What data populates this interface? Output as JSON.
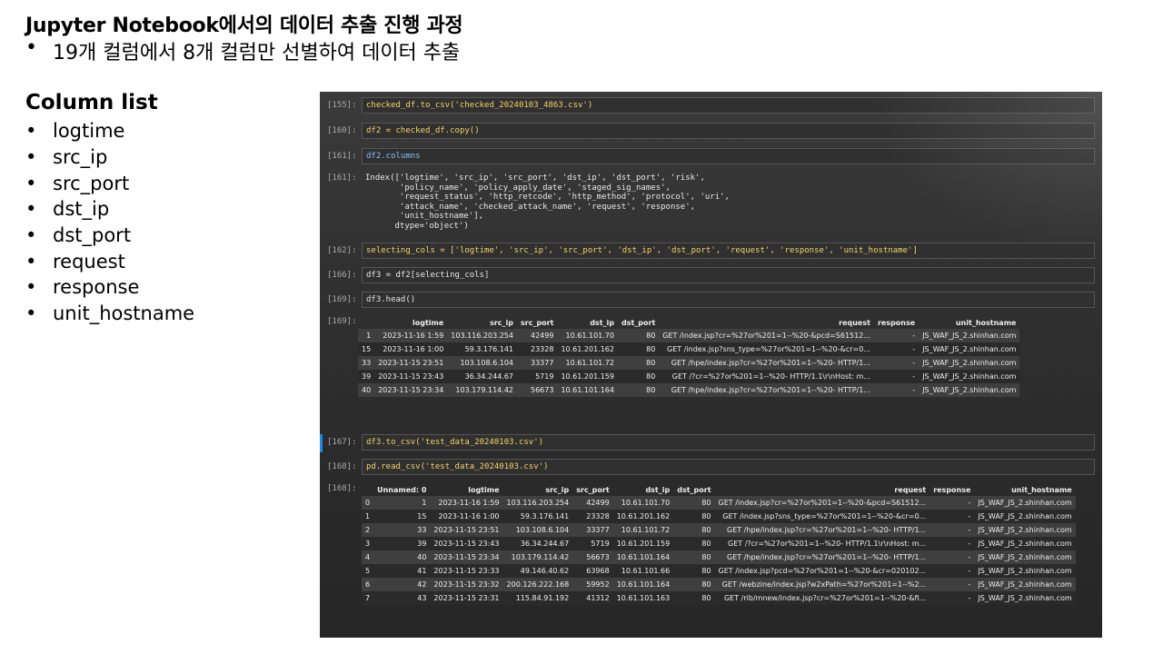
{
  "slide": {
    "title": "Jupyter Notebook에서의 데이터 추출 진행 과정",
    "bullet": "19개 컬럼에서 8개 컬럼만 선별하여 데이터 추출",
    "bullet_marker": "•",
    "column_list_title": "Column list",
    "columns": [
      "logtime",
      "src_ip",
      "src_port",
      "dst_ip",
      "dst_port",
      "request",
      "response",
      "unit_hostname"
    ]
  },
  "notebook": {
    "cells": [
      {
        "prompt": "[155]:",
        "code": "checked_df.to_csv('checked_20240103_4863.csv')"
      },
      {
        "prompt": "[160]:",
        "code": "df2 = checked_df.copy()"
      },
      {
        "prompt": "[161]:",
        "code": "df2.columns"
      },
      {
        "prompt": "[161]:",
        "output": "Index(['logtime', 'src_ip', 'src_port', 'dst_ip', 'dst_port', 'risk',\n       'policy_name', 'policy_apply_date', 'staged_sig_names',\n       'request_status', 'http_retcode', 'http_method', 'protocol', 'uri',\n       'attack_name', 'checked_attack_name', 'request', 'response',\n       'unit_hostname'],\n      dtype='object')"
      },
      {
        "prompt": "[162]:",
        "code": "selecting_cols = ['logtime', 'src_ip', 'src_port', 'dst_ip', 'dst_port', 'request', 'response', 'unit_hostname']"
      },
      {
        "prompt": "[166]:",
        "code": "df3 = df2[selecting_cols]"
      },
      {
        "prompt": "[169]:",
        "code": "df3.head()"
      },
      {
        "prompt": "[169]:"
      },
      {
        "prompt": "[167]:",
        "code": "df3.to_csv('test_data_20240103.csv')"
      },
      {
        "prompt": "[168]:",
        "code": "pd.read_csv('test_data_20240103.csv')"
      },
      {
        "prompt": "[168]:"
      }
    ],
    "head_table": {
      "headers": [
        "",
        "logtime",
        "src_ip",
        "src_port",
        "dst_ip",
        "dst_port",
        "request",
        "response",
        "unit_hostname"
      ],
      "rows": [
        [
          "1",
          "2023-11-16 1:59",
          "103.116.203.254",
          "42499",
          "10.61.101.70",
          "80",
          "GET /index.jsp?cr=%27or%201=1--%20-&pcd=S61512...",
          "-",
          "JS_WAF_JS_2.shinhan.com"
        ],
        [
          "15",
          "2023-11-16 1:00",
          "59.3.176.141",
          "23328",
          "10.61.201.162",
          "80",
          "GET /index.jsp?sns_type=%27or%201=1--%20-&cr=0...",
          "-",
          "JS_WAF_JS_2.shinhan.com"
        ],
        [
          "33",
          "2023-11-15 23:51",
          "103.108.6.104",
          "33377",
          "10.61.101.72",
          "80",
          "GET /hpe/index.jsp?cr=%27or%201=1--%20- HTTP/1...",
          "-",
          "JS_WAF_JS_2.shinhan.com"
        ],
        [
          "39",
          "2023-11-15 23:43",
          "36.34.244.67",
          "5719",
          "10.61.201.159",
          "80",
          "GET /?cr=%27or%201=1--%20- HTTP/1.1\\r\\nHost: m...",
          "-",
          "JS_WAF_JS_2.shinhan.com"
        ],
        [
          "40",
          "2023-11-15 23:34",
          "103.179.114.42",
          "56673",
          "10.61.101.164",
          "80",
          "GET /hpe/index.jsp?cr=%27or%201=1--%20- HTTP/1...",
          "-",
          "JS_WAF_JS_2.shinhan.com"
        ]
      ]
    },
    "csv_table": {
      "headers": [
        "",
        "Unnamed: 0",
        "logtime",
        "src_ip",
        "src_port",
        "dst_ip",
        "dst_port",
        "request",
        "response",
        "unit_hostname"
      ],
      "rows": [
        [
          "0",
          "1",
          "2023-11-16 1:59",
          "103.116.203.254",
          "42499",
          "10.61.101.70",
          "80",
          "GET /index.jsp?cr=%27or%201=1--%20-&pcd=S61512...",
          "-",
          "JS_WAF_JS_2.shinhan.com"
        ],
        [
          "1",
          "15",
          "2023-11-16 1:00",
          "59.3.176.141",
          "23328",
          "10.61.201.162",
          "80",
          "GET /index.jsp?sns_type=%27or%201=1--%20-&cr=0...",
          "-",
          "JS_WAF_JS_2.shinhan.com"
        ],
        [
          "2",
          "33",
          "2023-11-15 23:51",
          "103.108.6.104",
          "33377",
          "10.61.101.72",
          "80",
          "GET /hpe/index.jsp?cr=%27or%201=1--%20- HTTP/1...",
          "-",
          "JS_WAF_JS_2.shinhan.com"
        ],
        [
          "3",
          "39",
          "2023-11-15 23:43",
          "36.34.244.67",
          "5719",
          "10.61.201.159",
          "80",
          "GET /?cr=%27or%201=1--%20- HTTP/1.1\\r\\nHost: m...",
          "-",
          "JS_WAF_JS_2.shinhan.com"
        ],
        [
          "4",
          "40",
          "2023-11-15 23:34",
          "103.179.114.42",
          "56673",
          "10.61.101.164",
          "80",
          "GET /hpe/index.jsp?cr=%27or%201=1--%20- HTTP/1...",
          "-",
          "JS_WAF_JS_2.shinhan.com"
        ],
        [
          "5",
          "41",
          "2023-11-15 23:33",
          "49.146.40.62",
          "63968",
          "10.61.101.66",
          "80",
          "GET /index.jsp?pcd=%27or%201=1--%20-&cr=020102...",
          "-",
          "JS_WAF_JS_2.shinhan.com"
        ],
        [
          "6",
          "42",
          "2023-11-15 23:32",
          "200.126.222.168",
          "59952",
          "10.61.101.164",
          "80",
          "GET /webzine/index.jsp?w2xPath=%27or%201=1--%2...",
          "-",
          "JS_WAF_JS_2.shinhan.com"
        ],
        [
          "7",
          "43",
          "2023-11-15 23:31",
          "115.84.91.192",
          "41312",
          "10.61.101.163",
          "80",
          "GET /rib/mnew/index.jsp?cr=%27or%201=1--%20-&fi...",
          "-",
          "JS_WAF_JS_2.shinhan.com"
        ]
      ]
    }
  }
}
